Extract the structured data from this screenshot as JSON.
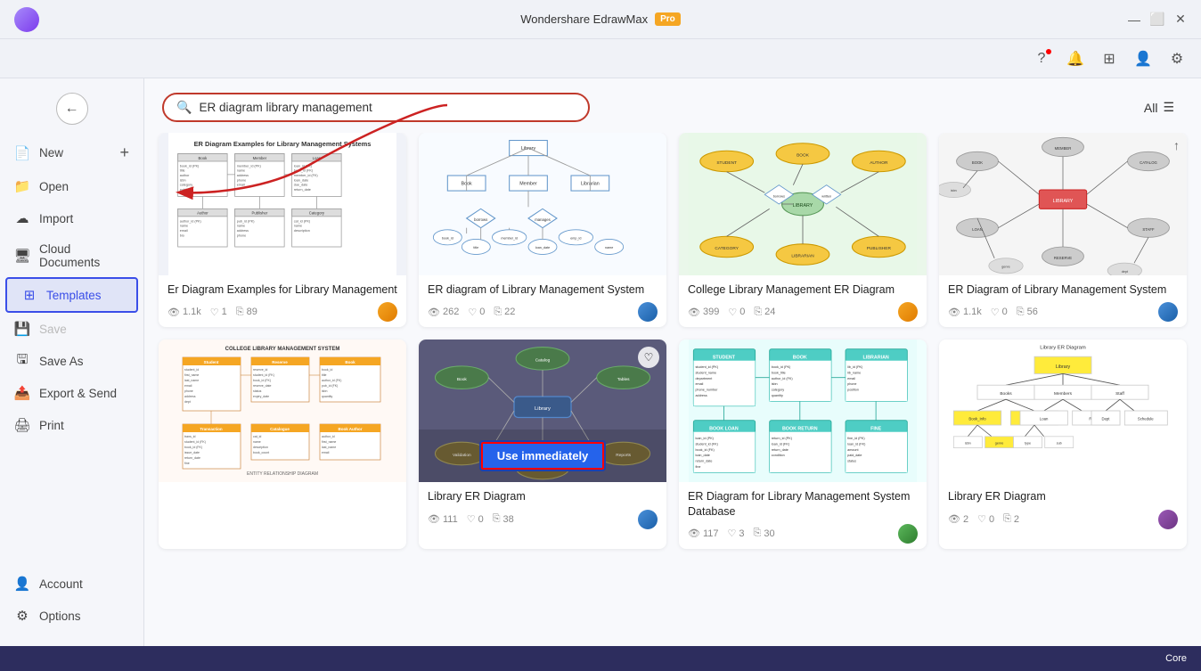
{
  "app": {
    "title": "Wondershare EdrawMax",
    "pro_badge": "Pro"
  },
  "titlebar": {
    "minimize": "—",
    "maximize": "⬜",
    "close": "✕"
  },
  "toolbar": {
    "icons": [
      "help",
      "notification",
      "layout",
      "user",
      "settings"
    ]
  },
  "sidebar": {
    "back_label": "←",
    "items": [
      {
        "id": "new",
        "label": "New",
        "icon": "➕",
        "has_plus": true
      },
      {
        "id": "open",
        "label": "Open",
        "icon": "📁"
      },
      {
        "id": "import",
        "label": "Import",
        "icon": "☁"
      },
      {
        "id": "cloud",
        "label": "Cloud Documents",
        "icon": "🖥"
      },
      {
        "id": "templates",
        "label": "Templates",
        "icon": "⊞",
        "active": true
      },
      {
        "id": "save",
        "label": "Save",
        "icon": "💾",
        "disabled": true
      },
      {
        "id": "saveas",
        "label": "Save As",
        "icon": "🖫"
      },
      {
        "id": "export",
        "label": "Export & Send",
        "icon": "📤"
      },
      {
        "id": "print",
        "label": "Print",
        "icon": "🖨"
      }
    ],
    "bottom_items": [
      {
        "id": "account",
        "label": "Account",
        "icon": "👤"
      },
      {
        "id": "options",
        "label": "Options",
        "icon": "⚙"
      }
    ]
  },
  "search": {
    "placeholder": "ER diagram library management",
    "value": "ER diagram library management",
    "all_label": "All"
  },
  "templates": [
    {
      "id": 1,
      "title": "Er Diagram Examples for Library Management",
      "views": "1.1k",
      "likes": "1",
      "copies": "89",
      "avatar_class": "avatar-orange",
      "style": "er-table"
    },
    {
      "id": 2,
      "title": "ER diagram of Library Management System",
      "views": "262",
      "likes": "0",
      "copies": "22",
      "avatar_class": "avatar-blue",
      "style": "er-flow"
    },
    {
      "id": 3,
      "title": "College Library Management ER Diagram",
      "views": "399",
      "likes": "0",
      "copies": "24",
      "avatar_class": "avatar-orange",
      "style": "college-er"
    },
    {
      "id": 4,
      "title": "ER Diagram of Library Management System",
      "views": "1.1k",
      "likes": "0",
      "copies": "56",
      "avatar_class": "avatar-blue",
      "style": "network-er",
      "has_upload_icon": true
    },
    {
      "id": 5,
      "title": "College Library Management System",
      "views": "",
      "likes": "",
      "copies": "",
      "avatar_class": "",
      "style": "college-table"
    },
    {
      "id": 6,
      "title": "Library ER Diagram",
      "views": "111",
      "likes": "0",
      "copies": "38",
      "avatar_class": "avatar-blue",
      "style": "library-er-dark",
      "show_use_btn": true,
      "show_heart": true
    },
    {
      "id": 7,
      "title": "ER Diagram for Library Management System Database",
      "views": "117",
      "likes": "3",
      "copies": "30",
      "avatar_class": "avatar-green",
      "style": "teal-er"
    },
    {
      "id": 8,
      "title": "Library ER Diagram",
      "views": "2",
      "likes": "0",
      "copies": "2",
      "avatar_class": "avatar-purple",
      "style": "yellow-er"
    }
  ],
  "footer": {
    "text": "Core"
  },
  "use_immediately_label": "Use immediately"
}
